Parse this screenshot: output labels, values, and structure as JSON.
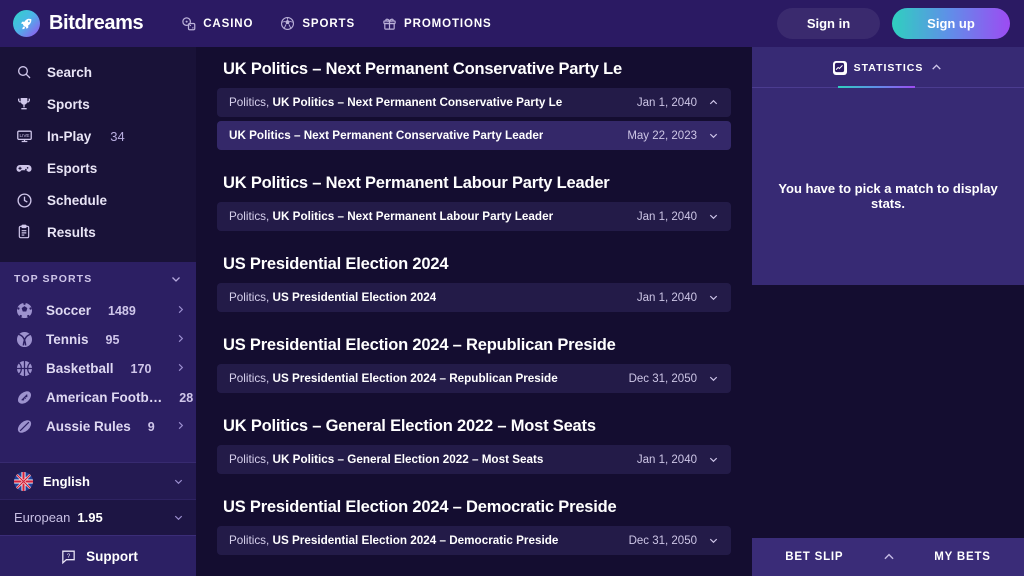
{
  "header": {
    "brand": "Bitdreams",
    "logo_icon": "rocket-icon",
    "nav": [
      {
        "label": "CASINO",
        "icon": "casino-chips-icon"
      },
      {
        "label": "SPORTS",
        "icon": "soccer-ball-icon"
      },
      {
        "label": "PROMOTIONS",
        "icon": "gift-icon"
      }
    ],
    "sign_in": "Sign in",
    "sign_up": "Sign up",
    "gradient_start": "#2fd0bf",
    "gradient_end": "#9d4bf2"
  },
  "sidebar": {
    "main_items": [
      {
        "label": "Search",
        "icon": "search-icon",
        "count": ""
      },
      {
        "label": "Sports",
        "icon": "trophy-icon",
        "count": ""
      },
      {
        "label": "In-Play",
        "icon": "live-monitor-icon",
        "count": "34"
      },
      {
        "label": "Esports",
        "icon": "gamepad-icon",
        "count": ""
      },
      {
        "label": "Schedule",
        "icon": "clock-icon",
        "count": ""
      },
      {
        "label": "Results",
        "icon": "clipboard-icon",
        "count": ""
      }
    ],
    "top_sports_header": "TOP SPORTS",
    "top_sports": [
      {
        "label": "Soccer",
        "count": "1489",
        "icon": "soccer-ball-icon"
      },
      {
        "label": "Tennis",
        "count": "95",
        "icon": "tennis-ball-icon"
      },
      {
        "label": "Basketball",
        "count": "170",
        "icon": "basketball-icon"
      },
      {
        "label": "American Footb…",
        "count": "28",
        "icon": "american-football-icon"
      },
      {
        "label": "Aussie Rules",
        "count": "9",
        "icon": "aussie-rules-ball-icon"
      }
    ],
    "language": "English",
    "language_flag": "uk-flag-icon",
    "odds_format": "European",
    "odds_value": "1.95",
    "support": "Support",
    "support_icon": "chat-help-icon"
  },
  "main": {
    "groups": [
      {
        "title": "UK Politics – Next Permanent Conservative Party Le",
        "rows": [
          {
            "category": "Politics,",
            "name": "UK Politics – Next Permanent Conservative Party Le",
            "date": "Jan 1, 2040",
            "chevron": "chevron-up-icon",
            "active": false
          },
          {
            "category": "",
            "name": "UK Politics – Next Permanent Conservative Party Leader",
            "date": "May 22, 2023",
            "chevron": "chevron-down-icon",
            "active": true
          }
        ]
      },
      {
        "title": "UK Politics – Next Permanent Labour Party Leader",
        "rows": [
          {
            "category": "Politics,",
            "name": "UK Politics – Next Permanent Labour Party Leader",
            "date": "Jan 1, 2040",
            "chevron": "chevron-down-icon",
            "active": false
          }
        ]
      },
      {
        "title": "US Presidential Election 2024",
        "rows": [
          {
            "category": "Politics,",
            "name": "US Presidential Election 2024",
            "date": "Jan 1, 2040",
            "chevron": "chevron-down-icon",
            "active": false
          }
        ]
      },
      {
        "title": "US Presidential Election 2024 – Republican Preside",
        "rows": [
          {
            "category": "Politics,",
            "name": "US Presidential Election 2024 – Republican Preside",
            "date": "Dec 31, 2050",
            "chevron": "chevron-down-icon",
            "active": false
          }
        ]
      },
      {
        "title": "UK Politics – General Election 2022 – Most Seats",
        "rows": [
          {
            "category": "Politics,",
            "name": "UK Politics – General Election 2022 – Most Seats",
            "date": "Jan 1, 2040",
            "chevron": "chevron-down-icon",
            "active": false
          }
        ]
      },
      {
        "title": "US Presidential Election 2024 – Democratic Preside",
        "rows": [
          {
            "category": "Politics,",
            "name": "US Presidential Election 2024 – Democratic Preside",
            "date": "Dec 31, 2050",
            "chevron": "chevron-down-icon",
            "active": false
          }
        ]
      }
    ]
  },
  "right": {
    "stats_tab": "STATISTICS",
    "stats_icon": "statistics-icon",
    "stats_collapse_icon": "chevron-up-icon",
    "stats_empty": "You have to pick a match to display stats.",
    "bet_slip": "BET SLIP",
    "my_bets": "MY BETS",
    "betbar_chevron": "chevron-up-icon"
  }
}
